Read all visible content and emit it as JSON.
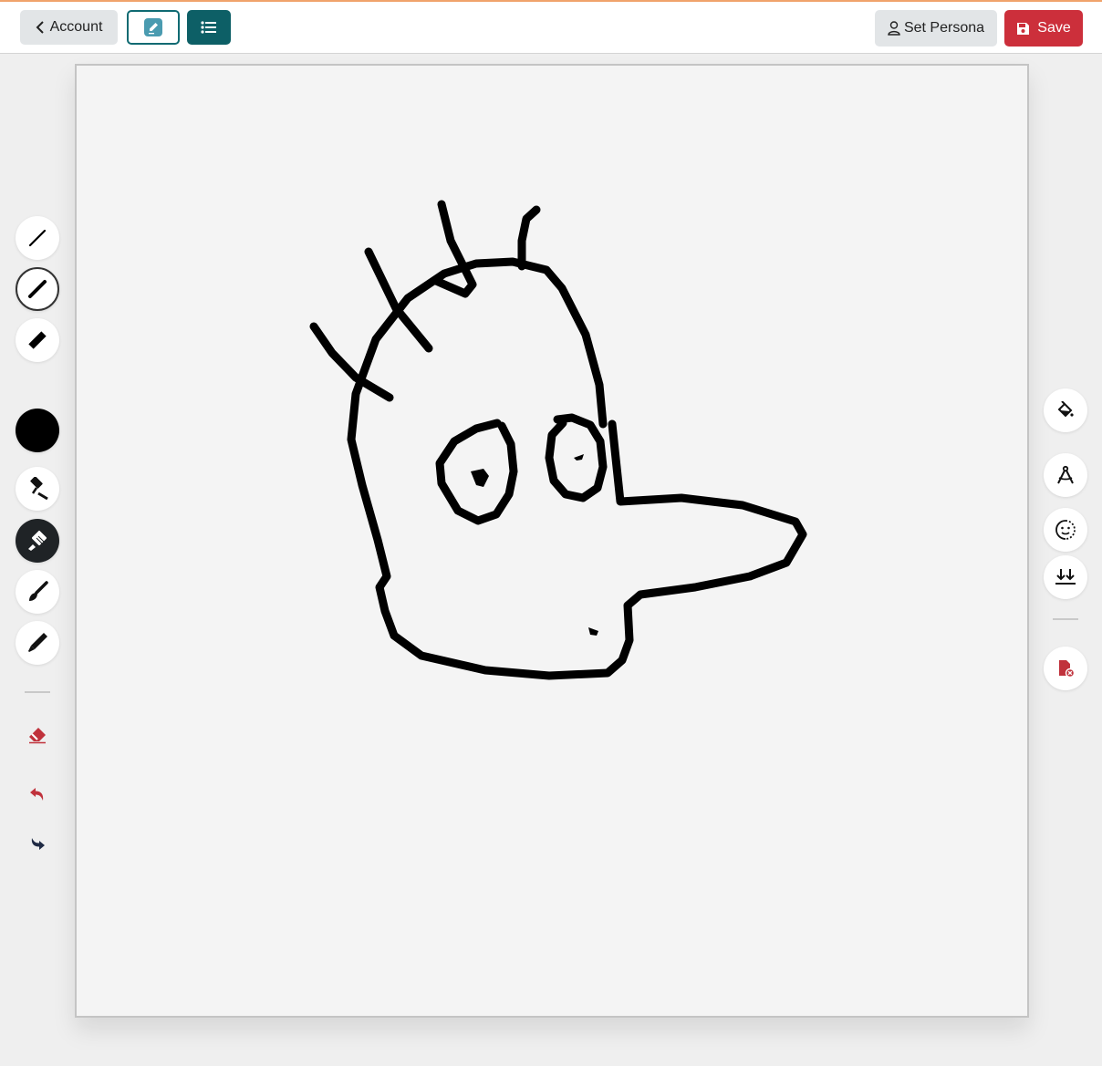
{
  "header": {
    "account_label": "Account",
    "persona_label": "Set Persona",
    "save_label": "Save"
  },
  "left_toolbar": {
    "stroke_widths": [
      "thin",
      "medium",
      "thick"
    ],
    "selected_stroke": "medium",
    "current_color": "#000000",
    "brushes": [
      "roller-brush-icon",
      "wide-brush-icon",
      "fine-brush-icon",
      "marker-icon"
    ],
    "selected_brush": "wide-brush-icon",
    "actions": [
      "eraser-icon",
      "undo-icon",
      "redo-icon"
    ]
  },
  "right_toolbar": {
    "tools": [
      "fill-bucket-icon",
      "compass-icon",
      "face-icon",
      "merge-down-icon"
    ],
    "actions": [
      "clear-document-icon"
    ]
  },
  "colors": {
    "accent_teal": "#0d5f66",
    "save_red": "#cc2f3b",
    "eraser_red": "#c0323c",
    "canvas_bg": "#f4f4f4"
  }
}
